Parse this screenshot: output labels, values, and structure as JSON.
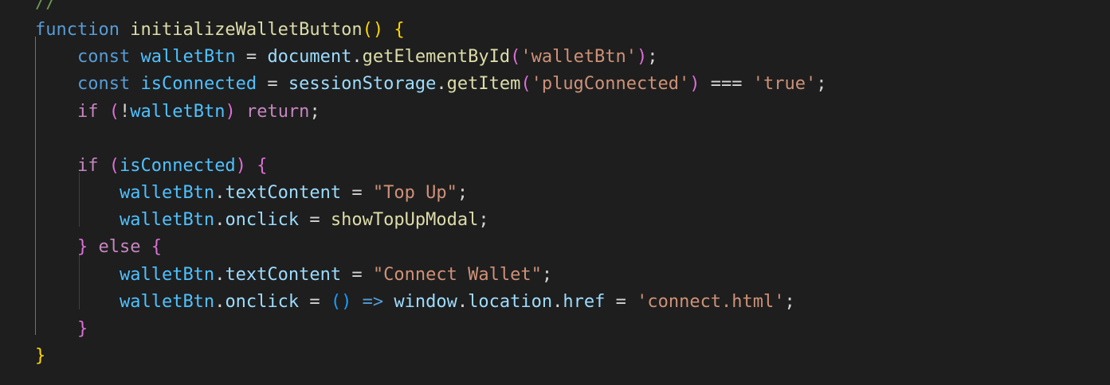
{
  "colors": {
    "background": "#1e1e1e",
    "keyword_blue": "#569cd6",
    "control_pink": "#c586c0",
    "function_yellow": "#dcdcaa",
    "variable_lightblue": "#9cdcfe",
    "constant_blue": "#4fc1ff",
    "string_orange": "#ce9178",
    "bracket_gold": "#ffd700",
    "bracket_orchid": "#da70d6",
    "bracket_blue": "#179fff",
    "comment_green": "#6a9955",
    "plain": "#d4d4d4"
  },
  "lines": [
    {
      "tokens": [
        {
          "t": "//",
          "c": "comment_green"
        }
      ]
    },
    {
      "tokens": [
        {
          "t": "function",
          "c": "keyword_blue"
        },
        {
          "t": " ",
          "c": "plain"
        },
        {
          "t": "initializeWalletButton",
          "c": "function_yellow"
        },
        {
          "t": "()",
          "c": "bracket_gold"
        },
        {
          "t": " ",
          "c": "plain"
        },
        {
          "t": "{",
          "c": "bracket_gold"
        }
      ]
    },
    {
      "tokens": [
        {
          "t": "    ",
          "c": "plain"
        },
        {
          "t": "const",
          "c": "keyword_blue"
        },
        {
          "t": " ",
          "c": "plain"
        },
        {
          "t": "walletBtn",
          "c": "constant_blue"
        },
        {
          "t": " = ",
          "c": "plain"
        },
        {
          "t": "document",
          "c": "variable_lightblue"
        },
        {
          "t": ".",
          "c": "plain"
        },
        {
          "t": "getElementById",
          "c": "function_yellow"
        },
        {
          "t": "(",
          "c": "bracket_orchid"
        },
        {
          "t": "'walletBtn'",
          "c": "string_orange"
        },
        {
          "t": ")",
          "c": "bracket_orchid"
        },
        {
          "t": ";",
          "c": "plain"
        }
      ]
    },
    {
      "tokens": [
        {
          "t": "    ",
          "c": "plain"
        },
        {
          "t": "const",
          "c": "keyword_blue"
        },
        {
          "t": " ",
          "c": "plain"
        },
        {
          "t": "isConnected",
          "c": "constant_blue"
        },
        {
          "t": " = ",
          "c": "plain"
        },
        {
          "t": "sessionStorage",
          "c": "variable_lightblue"
        },
        {
          "t": ".",
          "c": "plain"
        },
        {
          "t": "getItem",
          "c": "function_yellow"
        },
        {
          "t": "(",
          "c": "bracket_orchid"
        },
        {
          "t": "'plugConnected'",
          "c": "string_orange"
        },
        {
          "t": ")",
          "c": "bracket_orchid"
        },
        {
          "t": " === ",
          "c": "plain"
        },
        {
          "t": "'true'",
          "c": "string_orange"
        },
        {
          "t": ";",
          "c": "plain"
        }
      ]
    },
    {
      "tokens": [
        {
          "t": "    ",
          "c": "plain"
        },
        {
          "t": "if",
          "c": "control_pink"
        },
        {
          "t": " ",
          "c": "plain"
        },
        {
          "t": "(",
          "c": "bracket_orchid"
        },
        {
          "t": "!",
          "c": "plain"
        },
        {
          "t": "walletBtn",
          "c": "constant_blue"
        },
        {
          "t": ")",
          "c": "bracket_orchid"
        },
        {
          "t": " ",
          "c": "plain"
        },
        {
          "t": "return",
          "c": "control_pink"
        },
        {
          "t": ";",
          "c": "plain"
        }
      ]
    },
    {
      "tokens": []
    },
    {
      "tokens": [
        {
          "t": "    ",
          "c": "plain"
        },
        {
          "t": "if",
          "c": "control_pink"
        },
        {
          "t": " ",
          "c": "plain"
        },
        {
          "t": "(",
          "c": "bracket_orchid"
        },
        {
          "t": "isConnected",
          "c": "constant_blue"
        },
        {
          "t": ")",
          "c": "bracket_orchid"
        },
        {
          "t": " ",
          "c": "plain"
        },
        {
          "t": "{",
          "c": "bracket_orchid"
        }
      ]
    },
    {
      "tokens": [
        {
          "t": "        ",
          "c": "plain"
        },
        {
          "t": "walletBtn",
          "c": "constant_blue"
        },
        {
          "t": ".",
          "c": "plain"
        },
        {
          "t": "textContent",
          "c": "variable_lightblue"
        },
        {
          "t": " = ",
          "c": "plain"
        },
        {
          "t": "\"Top Up\"",
          "c": "string_orange"
        },
        {
          "t": ";",
          "c": "plain"
        }
      ]
    },
    {
      "tokens": [
        {
          "t": "        ",
          "c": "plain"
        },
        {
          "t": "walletBtn",
          "c": "constant_blue"
        },
        {
          "t": ".",
          "c": "plain"
        },
        {
          "t": "onclick",
          "c": "variable_lightblue"
        },
        {
          "t": " = ",
          "c": "plain"
        },
        {
          "t": "showTopUpModal",
          "c": "function_yellow"
        },
        {
          "t": ";",
          "c": "plain"
        }
      ]
    },
    {
      "tokens": [
        {
          "t": "    ",
          "c": "plain"
        },
        {
          "t": "}",
          "c": "bracket_orchid"
        },
        {
          "t": " ",
          "c": "plain"
        },
        {
          "t": "else",
          "c": "control_pink"
        },
        {
          "t": " ",
          "c": "plain"
        },
        {
          "t": "{",
          "c": "bracket_orchid"
        }
      ]
    },
    {
      "tokens": [
        {
          "t": "        ",
          "c": "plain"
        },
        {
          "t": "walletBtn",
          "c": "constant_blue"
        },
        {
          "t": ".",
          "c": "plain"
        },
        {
          "t": "textContent",
          "c": "variable_lightblue"
        },
        {
          "t": " = ",
          "c": "plain"
        },
        {
          "t": "\"Connect Wallet\"",
          "c": "string_orange"
        },
        {
          "t": ";",
          "c": "plain"
        }
      ]
    },
    {
      "tokens": [
        {
          "t": "        ",
          "c": "plain"
        },
        {
          "t": "walletBtn",
          "c": "constant_blue"
        },
        {
          "t": ".",
          "c": "plain"
        },
        {
          "t": "onclick",
          "c": "variable_lightblue"
        },
        {
          "t": " = ",
          "c": "plain"
        },
        {
          "t": "()",
          "c": "bracket_blue"
        },
        {
          "t": " ",
          "c": "plain"
        },
        {
          "t": "=>",
          "c": "keyword_blue"
        },
        {
          "t": " ",
          "c": "plain"
        },
        {
          "t": "window",
          "c": "variable_lightblue"
        },
        {
          "t": ".",
          "c": "plain"
        },
        {
          "t": "location",
          "c": "variable_lightblue"
        },
        {
          "t": ".",
          "c": "plain"
        },
        {
          "t": "href",
          "c": "variable_lightblue"
        },
        {
          "t": " = ",
          "c": "plain"
        },
        {
          "t": "'connect.html'",
          "c": "string_orange"
        },
        {
          "t": ";",
          "c": "plain"
        }
      ]
    },
    {
      "tokens": [
        {
          "t": "    ",
          "c": "plain"
        },
        {
          "t": "}",
          "c": "bracket_orchid"
        }
      ]
    },
    {
      "tokens": [
        {
          "t": "}",
          "c": "bracket_gold"
        }
      ]
    }
  ]
}
